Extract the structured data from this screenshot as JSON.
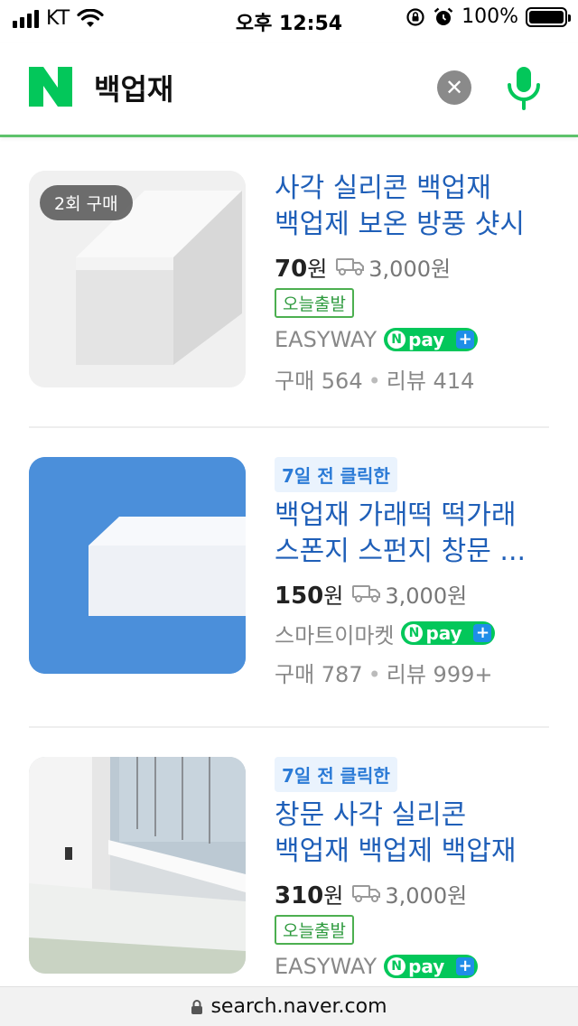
{
  "status_bar": {
    "carrier": "KT",
    "time": "오후 12:54",
    "battery": "100%"
  },
  "search": {
    "query": "백업재"
  },
  "products": [
    {
      "badge": "2회 구매",
      "title": "사각 실리콘 백업재 백업제 보온 방풍 샷시 ...",
      "price": "70",
      "price_unit": "원",
      "shipping": "3,000원",
      "today_badge": "오늘출발",
      "seller": "EASYWAY",
      "purchases": "구매 564",
      "reviews": "리뷰 414"
    },
    {
      "click_badge": "7일 전 클릭한",
      "title": "백업재 가래떡 떡가래 스폰지 스펀지 창문 ...",
      "price": "150",
      "price_unit": "원",
      "shipping": "3,000원",
      "seller": "스마트이마켓",
      "purchases": "구매 787",
      "reviews": "리뷰 999+"
    },
    {
      "click_badge": "7일 전 클릭한",
      "title": "창문 사각 실리콘 백업재 백업제 백압재 가...",
      "price": "310",
      "price_unit": "원",
      "shipping": "3,000원",
      "today_badge": "오늘출발",
      "seller": "EASYWAY"
    }
  ],
  "npay": {
    "text": "pay",
    "n_letter": "N"
  },
  "url_bar": {
    "url": "search.naver.com"
  },
  "colors": {
    "naver_green": "#03c75a",
    "link_blue": "#1f5fb8",
    "header_border": "#5ec26b"
  }
}
